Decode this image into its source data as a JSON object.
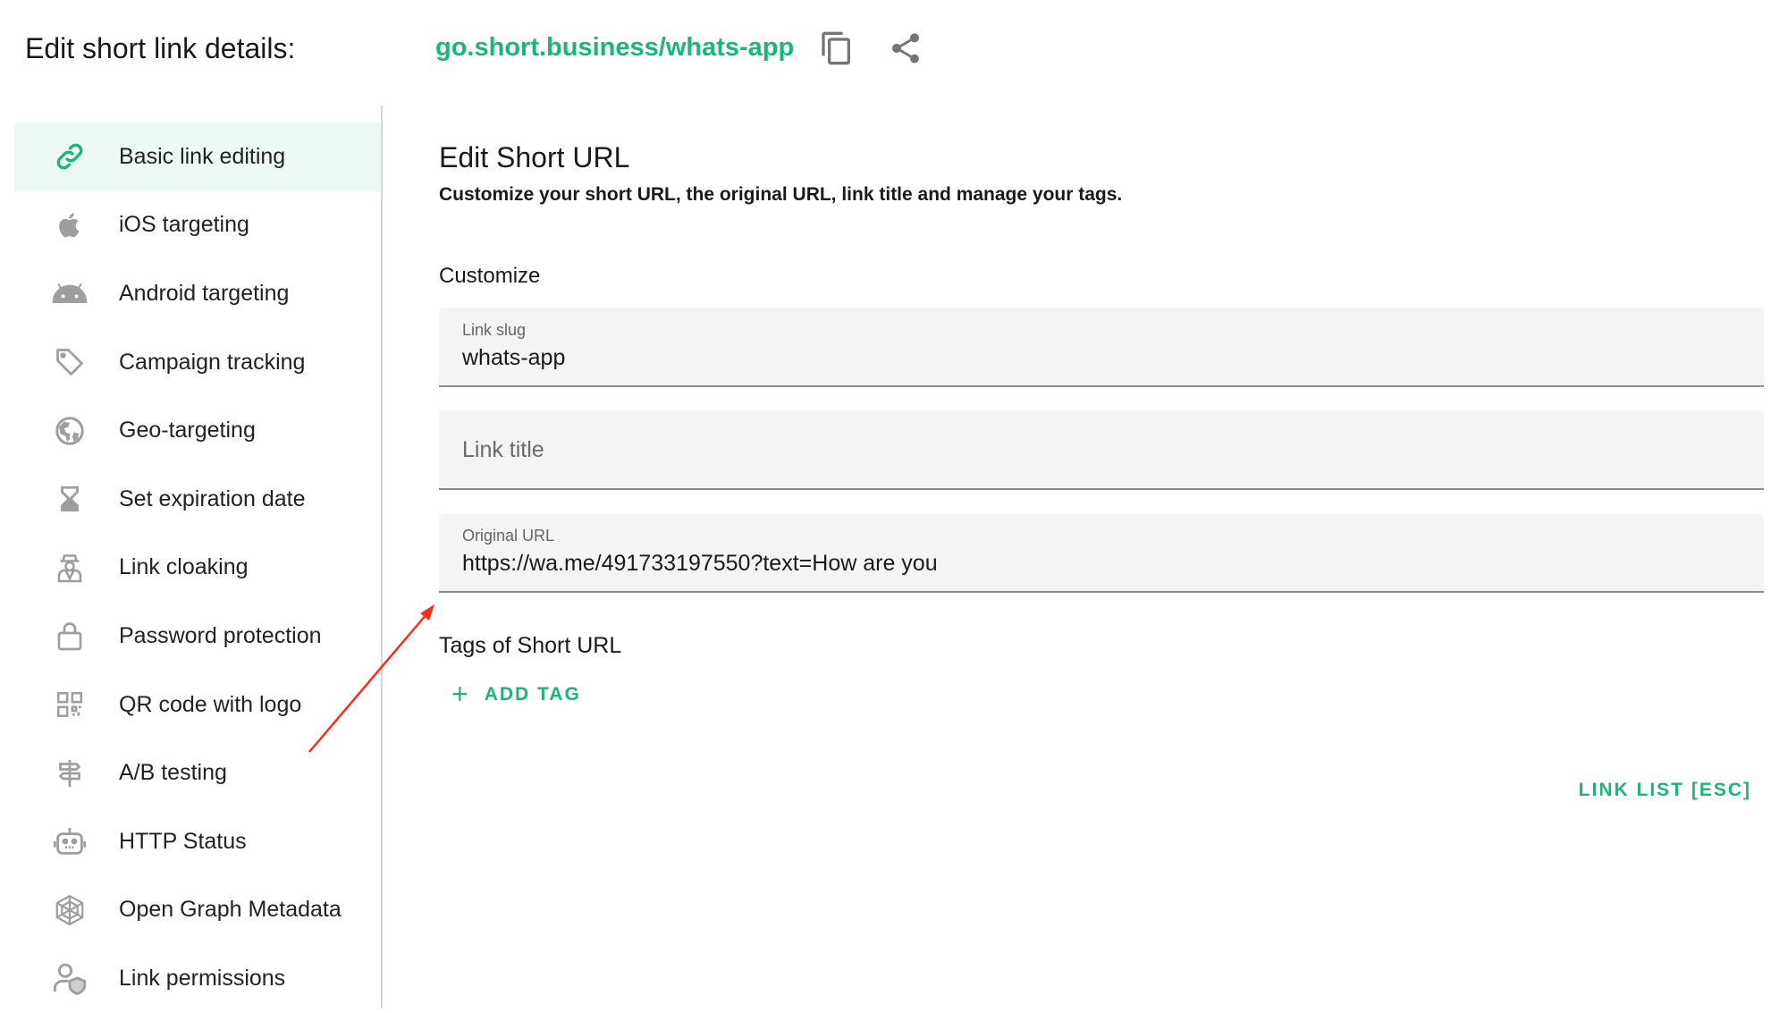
{
  "header": {
    "title": "Edit short link details:",
    "short_url": "go.short.business/whats-app",
    "copy_icon": "copy-icon",
    "share_icon": "share-icon"
  },
  "sidebar": {
    "items": [
      {
        "label": "Basic link editing",
        "icon": "link-icon",
        "active": true
      },
      {
        "label": "iOS targeting",
        "icon": "apple-icon"
      },
      {
        "label": "Android targeting",
        "icon": "android-icon"
      },
      {
        "label": "Campaign tracking",
        "icon": "tag-icon"
      },
      {
        "label": "Geo-targeting",
        "icon": "globe-icon"
      },
      {
        "label": "Set expiration date",
        "icon": "hourglass-icon"
      },
      {
        "label": "Link cloaking",
        "icon": "spy-icon"
      },
      {
        "label": "Password protection",
        "icon": "lock-icon"
      },
      {
        "label": "QR code with logo",
        "icon": "qr-code-icon"
      },
      {
        "label": "A/B testing",
        "icon": "signpost-icon"
      },
      {
        "label": "HTTP Status",
        "icon": "robot-icon"
      },
      {
        "label": "Open Graph Metadata",
        "icon": "spider-web-icon"
      },
      {
        "label": "Link permissions",
        "icon": "user-shield-icon"
      }
    ]
  },
  "main": {
    "title": "Edit Short URL",
    "subtitle": "Customize your short URL, the original URL, link title and manage your tags.",
    "customize_label": "Customize",
    "slug": {
      "label": "Link slug",
      "value": "whats-app"
    },
    "link_title": {
      "placeholder": "Link title",
      "value": ""
    },
    "original_url": {
      "label": "Original URL",
      "value": "https://wa.me/491733197550?text=How are you"
    },
    "tags_title": "Tags of Short URL",
    "add_tag_label": "ADD TAG",
    "link_list_label": "LINK LIST [ESC]"
  },
  "colors": {
    "accent": "#1db47c",
    "active_bg": "#ecf8f3",
    "icon_grey": "#9e9e9e",
    "annotation_arrow": "#ff2a1a"
  }
}
